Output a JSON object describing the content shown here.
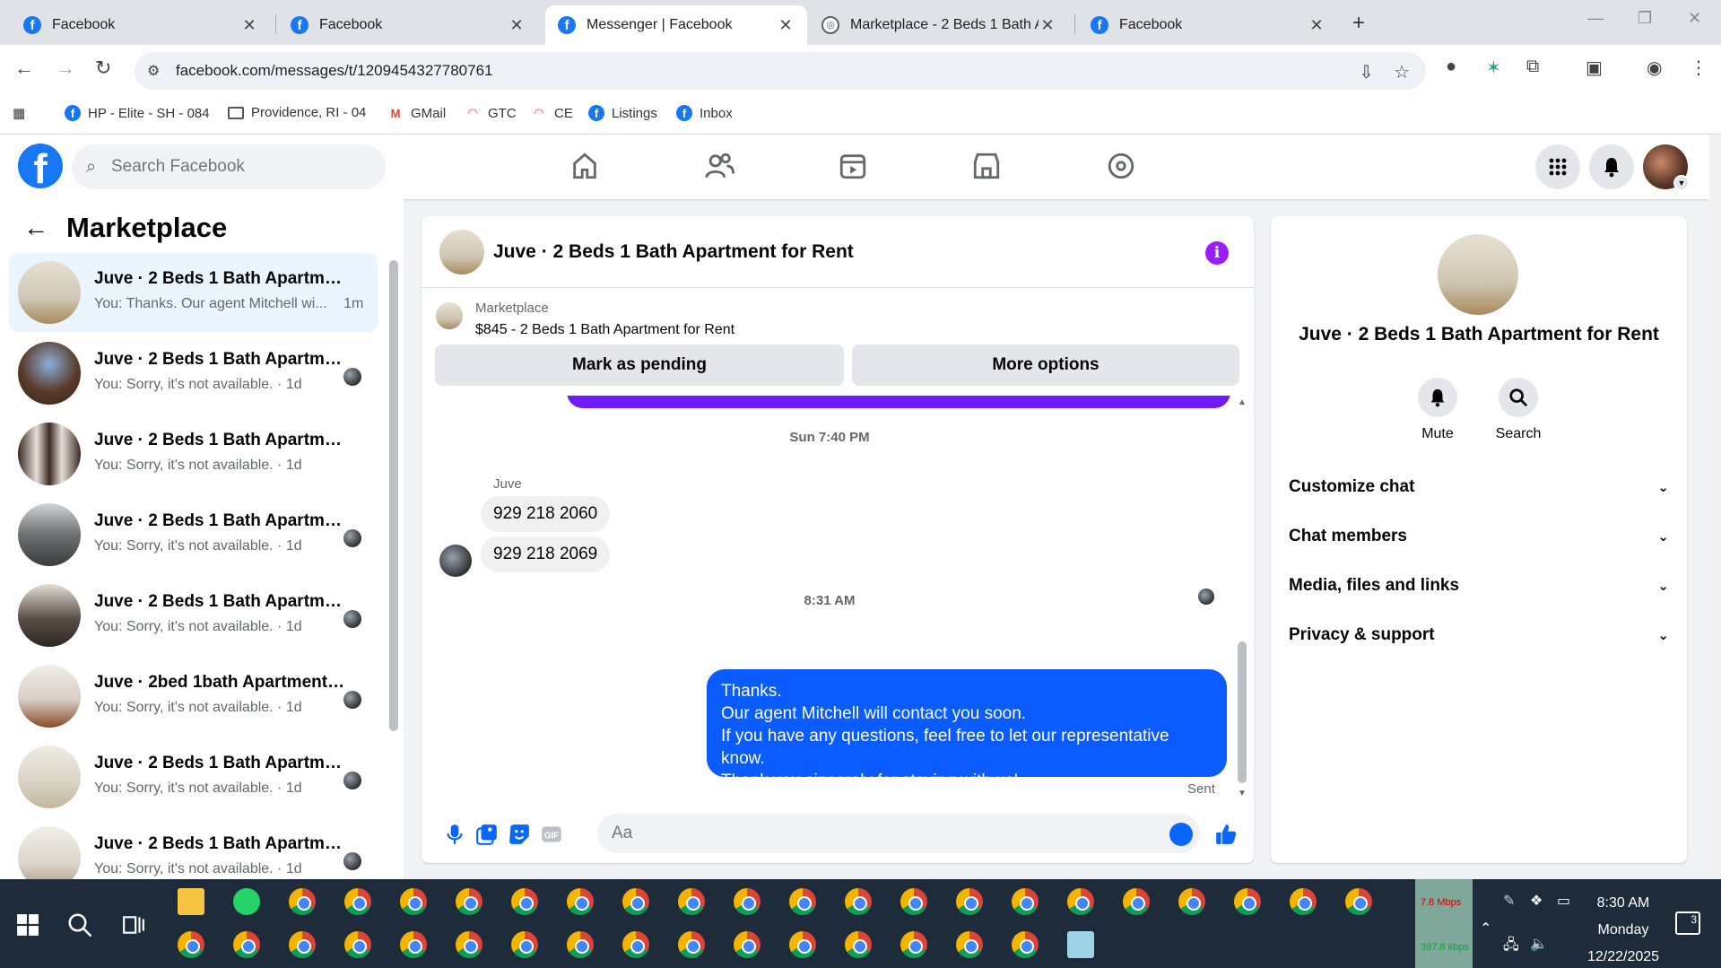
{
  "browser": {
    "tabs": [
      {
        "title": "Facebook",
        "icon": "facebook-icon"
      },
      {
        "title": "Facebook",
        "icon": "facebook-icon"
      },
      {
        "title": "Messenger | Facebook",
        "icon": "facebook-icon",
        "active": true
      },
      {
        "title": "Marketplace - 2 Beds 1 Bath Ap",
        "icon": "marketplace-icon"
      },
      {
        "title": "Facebook",
        "icon": "facebook-icon"
      }
    ],
    "url": "facebook.com/messages/t/1209454327780761",
    "bookmarks": [
      {
        "label": "HP - Elite - SH - 084",
        "icon": "facebook-icon"
      },
      {
        "label": "Providence, RI - 04",
        "icon": "folder-icon"
      },
      {
        "label": "GMail",
        "icon": "gmail-icon"
      },
      {
        "label": "GTC",
        "icon": "rainbow-icon"
      },
      {
        "label": "CE",
        "icon": "rainbow-icon"
      },
      {
        "label": "Listings",
        "icon": "facebook-icon"
      },
      {
        "label": "Inbox",
        "icon": "facebook-icon"
      }
    ]
  },
  "facebook": {
    "search_placeholder": "Search Facebook",
    "brand_color": "#1877f2"
  },
  "left_panel": {
    "title": "Marketplace",
    "conversations": [
      {
        "name": "Juve · 2 Beds 1 Bath Apartment for Rent",
        "preview": "You: Thanks. Our agent Mitchell wi...",
        "time": "1m",
        "selected": true
      },
      {
        "name": "Juve · 2 Beds 1 Bath Apartment for Rent",
        "preview": "You: Sorry, it's not available.",
        "time": "1d"
      },
      {
        "name": "Juve · 2 Beds 1 Bath Apartment",
        "preview": "You: Sorry, it's not available.",
        "time": "1d"
      },
      {
        "name": "Juve · 2 Beds 1 Bath Apartment",
        "preview": "You: Sorry, it's not available.",
        "time": "1d"
      },
      {
        "name": "Juve · 2 Beds 1 Bath Apartment",
        "preview": "You: Sorry, it's not available.",
        "time": "1d"
      },
      {
        "name": "Juve · 2bed 1bath Apartment for Rent",
        "preview": "You: Sorry, it's not available.",
        "time": "1d"
      },
      {
        "name": "Juve · 2 Beds 1 Bath Apartment for Rent",
        "preview": "You: Sorry, it's not available.",
        "time": "1d"
      },
      {
        "name": "Juve · 2 Beds 1 Bath Apartment for Rent",
        "preview": "You: Sorry, it's not available.",
        "time": "1d"
      }
    ]
  },
  "chat": {
    "title": "Juve · 2 Beds 1 Bath Apartment for Rent",
    "marketplace_label": "Marketplace",
    "listing": "$845 - 2 Beds 1 Bath Apartment for Rent",
    "mark_pending": "Mark as pending",
    "more_options": "More options",
    "timestamp1": "Sun 7:40 PM",
    "sender": "Juve",
    "incoming": [
      "929 218 2060",
      "929 218 2069"
    ],
    "timestamp2": "8:31 AM",
    "outgoing": [
      "Thanks.",
      "Our agent Mitchell will contact you soon.",
      "If you have any questions, feel free to let our representative know.",
      "Thank you sincerely for staying with us!"
    ],
    "status": "Sent",
    "composer_placeholder": "Aa",
    "accent": "#0866ff",
    "info_color": "#9a1cff"
  },
  "right_panel": {
    "title": "Juve · 2 Beds 1 Bath Apartment for Rent",
    "mute": "Mute",
    "search": "Search",
    "sections": [
      "Customize chat",
      "Chat members",
      "Media, files and links",
      "Privacy & support"
    ]
  },
  "taskbar": {
    "upload": "7.8 Mbps",
    "download": "397.8 kbps",
    "time": "8:30 AM",
    "day": "Monday",
    "date": "12/22/2025",
    "notifications": "3"
  }
}
